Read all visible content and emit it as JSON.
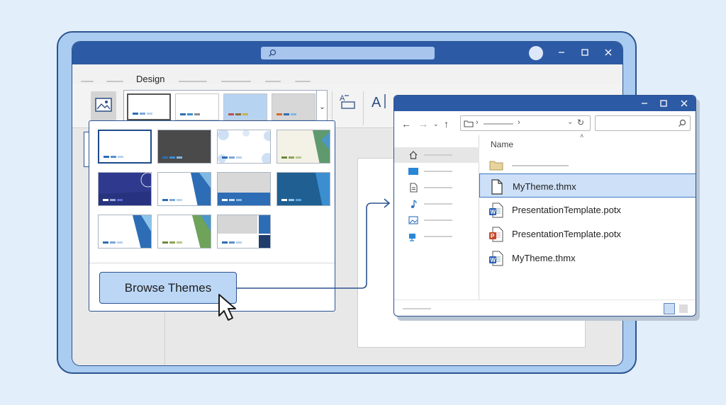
{
  "ppt": {
    "active_tab": "Design",
    "theme_strip": [
      {
        "bg": "#ffffff",
        "bars": [
          "#2d6db5",
          "#7aa7d8",
          "#b9d2ee"
        ]
      },
      {
        "bg": "#ffffff",
        "bars": [
          "#2d6db5",
          "#3e8fc9",
          "#8c8c8c"
        ]
      },
      {
        "bg": "#b7d3f2",
        "bars": [
          "#c0504d",
          "#8a6d3b",
          "#c8b24a"
        ]
      },
      {
        "bg": "#d7d7d7",
        "bars": [
          "#d56a2e",
          "#2d6db5",
          "#7fb8e3"
        ]
      }
    ]
  },
  "gallery": {
    "themes": [
      {
        "name": "theme-office",
        "selected": true
      },
      {
        "name": "theme-dark-gray"
      },
      {
        "name": "theme-dots"
      },
      {
        "name": "theme-green-facets"
      },
      {
        "name": "theme-indigo"
      },
      {
        "name": "theme-blue-waves"
      },
      {
        "name": "theme-checker-blue"
      },
      {
        "name": "theme-navy-facets"
      },
      {
        "name": "theme-blue-facets"
      },
      {
        "name": "theme-green-blue-facets"
      },
      {
        "name": "theme-block-blue"
      }
    ],
    "browse_label": "Browse Themes"
  },
  "explorer": {
    "column_header": "Name",
    "files": [
      {
        "name": "",
        "type": "folder",
        "selected": false
      },
      {
        "name": "MyTheme.thmx",
        "type": "generic",
        "selected": true
      },
      {
        "name": "PresentationTemplate.potx",
        "type": "word",
        "selected": false
      },
      {
        "name": "PresentationTemplate.potx",
        "type": "powerpoint",
        "selected": false
      },
      {
        "name": "MyTheme.thmx",
        "type": "word",
        "selected": false
      }
    ],
    "sidebar_icons": [
      "home-icon",
      "desktop-icon",
      "documents-icon",
      "music-icon",
      "pictures-icon",
      "network-icon"
    ]
  },
  "colors": {
    "accent": "#2d5aa5",
    "selection": "#cde0f7",
    "browse_button": "#bcd7f6",
    "tab_underline": "#d24726"
  }
}
